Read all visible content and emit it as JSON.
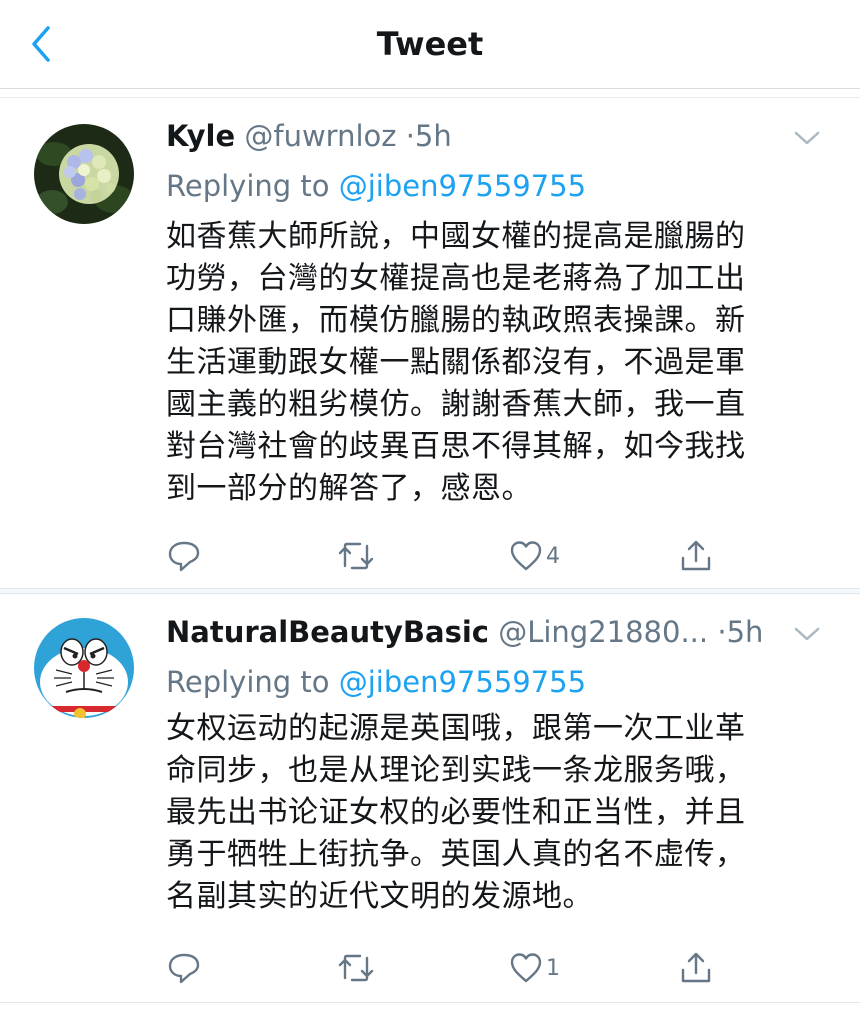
{
  "header": {
    "title": "Tweet"
  },
  "tweets": [
    {
      "name": "Kyle",
      "handle": "@fuwrnloz",
      "dot": "·",
      "time": "5h",
      "reply_prefix": "Replying to",
      "reply_to": "@jiben97559755",
      "lines": [
        "如香蕉大師所說，中國女權的提高是臘腸的",
        "功勞，台灣的女權提高也是老蔣為了加工出",
        "口賺外匯，而模仿臘腸的執政照表操課。新",
        "生活運動跟女權一點關係都沒有，不過是軍",
        "國主義的粗劣模仿。謝謝香蕉大師，我一直",
        "對台灣社會的歧異百思不得其解，如今我找",
        "到一部分的解答了，感恩。"
      ],
      "like_count": "4"
    },
    {
      "name": "NaturalBeautyBasic",
      "handle": "@Ling21880...",
      "dot": "·",
      "time": "5h",
      "reply_prefix": "Replying to",
      "reply_to": "@jiben97559755",
      "lines": [
        "女权运动的起源是英国哦，跟第一次工业革",
        "命同步，也是从理论到实践一条龙服务哦，",
        "最先出书论证女权的必要性和正当性，并且",
        "勇于牺牲上街抗争。英国人真的名不虚传，",
        "名副其实的近代文明的发源地。"
      ],
      "like_count": "1"
    }
  ],
  "icons": {
    "back": "chevron-left-icon",
    "menu": "chevron-down-icon",
    "reply": "reply-icon",
    "retweet": "retweet-icon",
    "like": "heart-icon",
    "share": "share-icon"
  },
  "colors": {
    "accent": "#1da1f2",
    "text": "#14171a",
    "muted": "#657786",
    "divider": "#e1e8ed"
  }
}
